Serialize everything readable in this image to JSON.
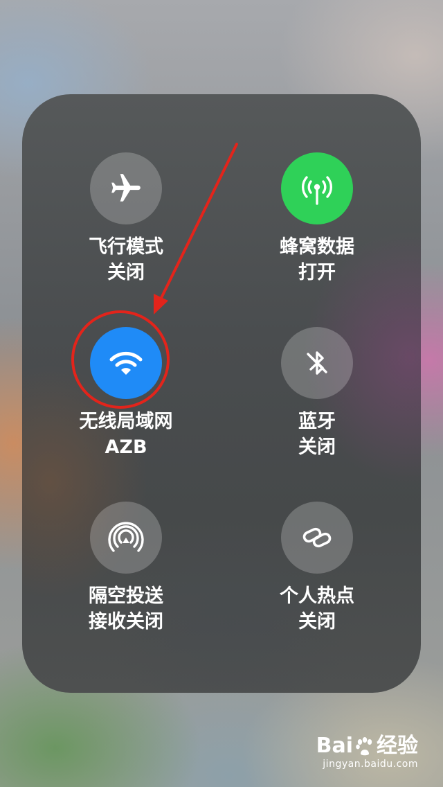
{
  "tiles": {
    "airplane": {
      "title": "飞行模式",
      "status": "关闭",
      "icon": "airplane-icon"
    },
    "cellular": {
      "title": "蜂窝数据",
      "status": "打开",
      "icon": "cellular-antenna-icon",
      "color": "#2fd158"
    },
    "wifi": {
      "title": "无线局域网",
      "status": "AZB",
      "icon": "wifi-icon",
      "color": "#1f8bf7"
    },
    "bluetooth": {
      "title": "蓝牙",
      "status": "关闭",
      "icon": "bluetooth-off-icon"
    },
    "airdrop": {
      "title": "隔空投送",
      "status": "接收关闭",
      "icon": "airdrop-icon"
    },
    "hotspot": {
      "title": "个人热点",
      "status": "关闭",
      "icon": "hotspot-link-icon"
    }
  },
  "annotation": {
    "color": "#e3241b"
  },
  "watermark": {
    "brand_left": "Bai",
    "brand_right": "经验",
    "url": "jingyan.baidu.com"
  }
}
